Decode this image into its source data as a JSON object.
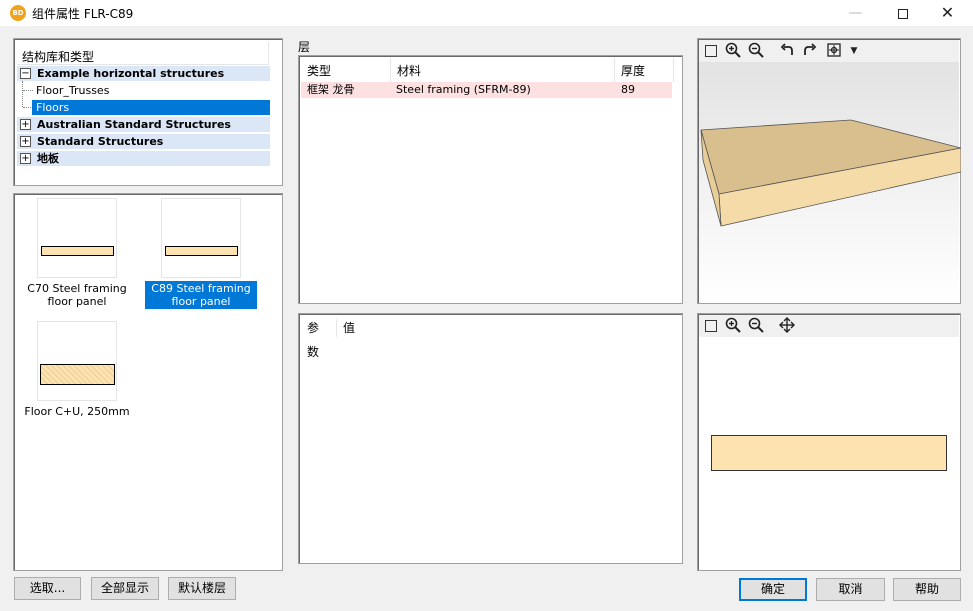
{
  "window": {
    "app_icon_text": "BD",
    "title": "组件属性 FLR-C89",
    "minimize_icon": "—",
    "close_icon": "✕"
  },
  "tree": {
    "header": "结构库和类型",
    "groups": [
      {
        "label": "Example horizontal structures",
        "expander": "−",
        "expanded": true,
        "children": [
          "Floor_Trusses",
          "Floors"
        ]
      },
      {
        "label": "Australian Standard Structures",
        "expander": "+"
      },
      {
        "label": "Standard Structures",
        "expander": "+"
      },
      {
        "label": "地板",
        "expander": "+"
      }
    ],
    "selected": "Floors"
  },
  "items": [
    {
      "caption": "C70 Steel framing floor panel",
      "selected": false,
      "swatch": "thin"
    },
    {
      "caption": "C89 Steel framing floor panel",
      "selected": true,
      "swatch": "thin"
    },
    {
      "caption": "Floor C+U, 250mm",
      "selected": false,
      "swatch": "thick"
    }
  ],
  "layers": {
    "label": "层",
    "columns": [
      "类型",
      "材料",
      "厚度"
    ],
    "rows": [
      {
        "type": "框架 龙骨",
        "material": "Steel framing (SFRM-89)",
        "thickness": "89"
      }
    ]
  },
  "params": {
    "columns": [
      "参数",
      "值"
    ]
  },
  "view3d": {
    "tools": [
      "fit-view-icon",
      "zoom-in-icon",
      "zoom-out-icon",
      "rotate-left-icon",
      "rotate-right-icon",
      "view-options-icon",
      "dropdown-arrow-icon"
    ]
  },
  "view2d": {
    "tools": [
      "fit-view-icon",
      "zoom-in-icon",
      "zoom-out-icon",
      "pan-icon"
    ]
  },
  "buttons": {
    "select": "选取...",
    "show_all": "全部显示",
    "default_floor": "默认楼层",
    "ok": "确定",
    "cancel": "取消",
    "help": "帮助"
  },
  "colors": {
    "selection": "#0078d7",
    "group_row": "#dbe6f6",
    "layer_row": "#fde0e0",
    "material_fill": "#fde3b0",
    "slab_top": "#d9bf8e",
    "slab_front": "#f5dba8"
  }
}
